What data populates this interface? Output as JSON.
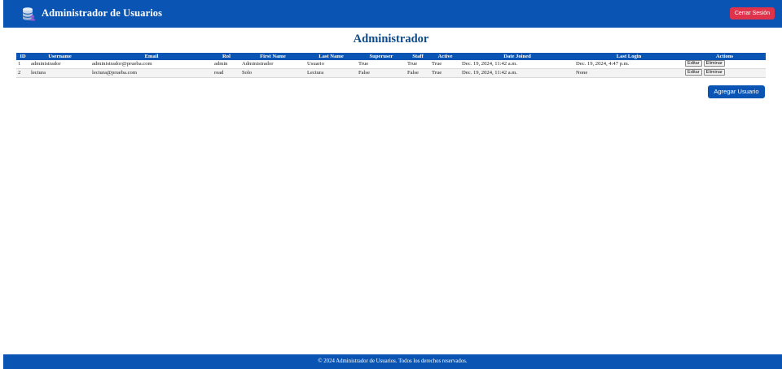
{
  "header": {
    "title": "Administrador de Usuarios",
    "logo_icon": "database-user-icon",
    "logout_label": "Cerrar Sesión"
  },
  "page": {
    "title": "Administrador"
  },
  "table": {
    "columns": [
      "ID",
      "Username",
      "Email",
      "Rol",
      "First Name",
      "Last Name",
      "Superuser",
      "Staff",
      "Active",
      "Date Joined",
      "Last Login",
      "Actions"
    ],
    "rows": [
      {
        "id": "1",
        "username": "administrador",
        "email": "administrador@prueba.com",
        "rol": "admin",
        "first_name": "Administrador",
        "last_name": "Usuario",
        "superuser": "True",
        "staff": "True",
        "active": "True",
        "date_joined": "Dec. 19, 2024, 11:42 a.m.",
        "last_login": "Dec. 19, 2024, 4:47 p.m.",
        "edit_label": "Editar",
        "delete_label": "Eliminar"
      },
      {
        "id": "2",
        "username": "lectura",
        "email": "lectura@prueba.com",
        "rol": "read",
        "first_name": "Solo",
        "last_name": "Lectura",
        "superuser": "False",
        "staff": "False",
        "active": "True",
        "date_joined": "Dec. 19, 2024, 11:42 a.m.",
        "last_login": "None",
        "edit_label": "Editar",
        "delete_label": "Eliminar"
      }
    ]
  },
  "add_user_label": "Agregar Usuario",
  "footer": {
    "text": "© 2024 Administrador de Usuarios. Todos los derechos reservados."
  },
  "colors": {
    "primary": "#0a55b3",
    "title": "#0c4a8a",
    "danger": "#e0324b"
  }
}
